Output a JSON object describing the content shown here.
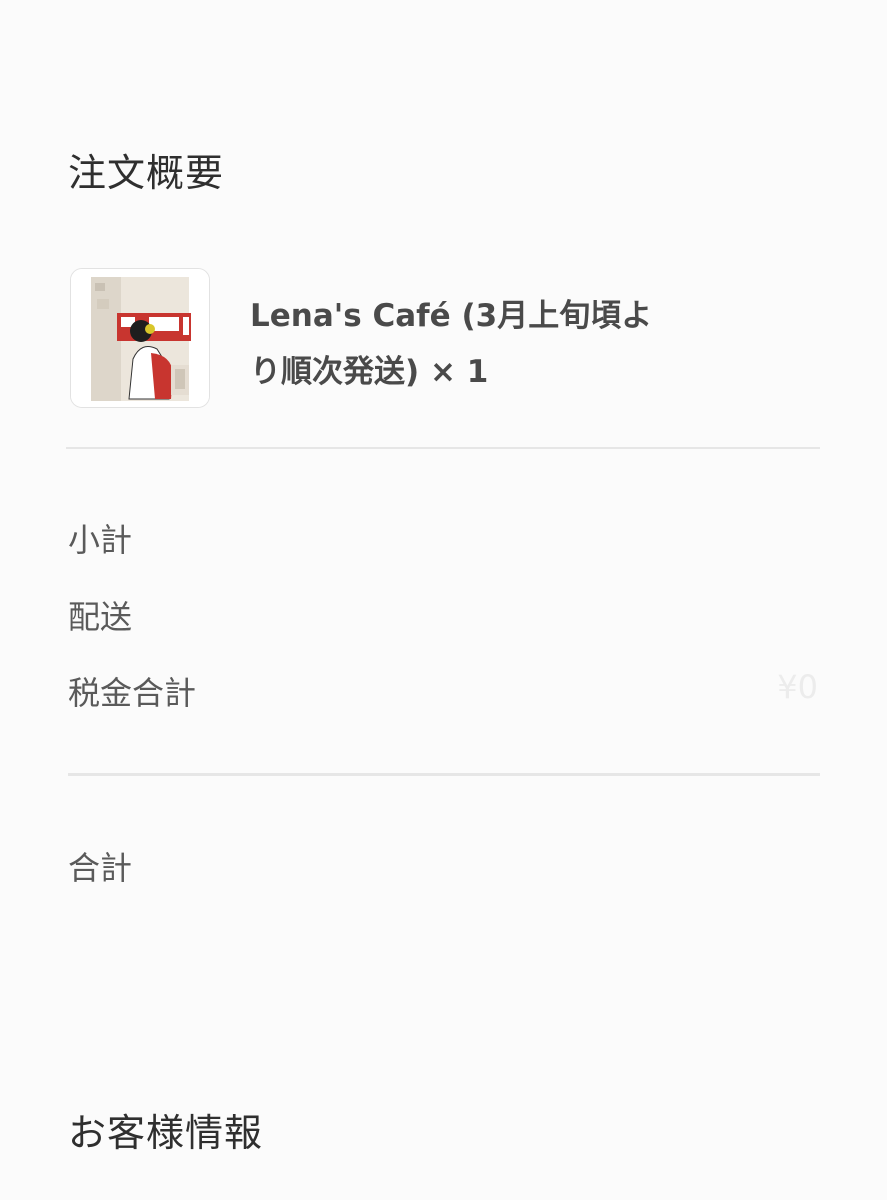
{
  "order_summary": {
    "title": "注文概要",
    "item": {
      "name": "Lena's Café (3月上旬頃より順次発送) × 1",
      "price": "",
      "thumbnail_icon": "product-artwork-thumbnail"
    },
    "lines": {
      "subtotal_label": "小計",
      "subtotal_value": "",
      "shipping_label": "配送",
      "shipping_value": "",
      "tax_label": "税金合計",
      "tax_value": "¥0"
    },
    "total": {
      "label": "合計",
      "value": ""
    }
  },
  "customer_info": {
    "title": "お客様情報"
  }
}
